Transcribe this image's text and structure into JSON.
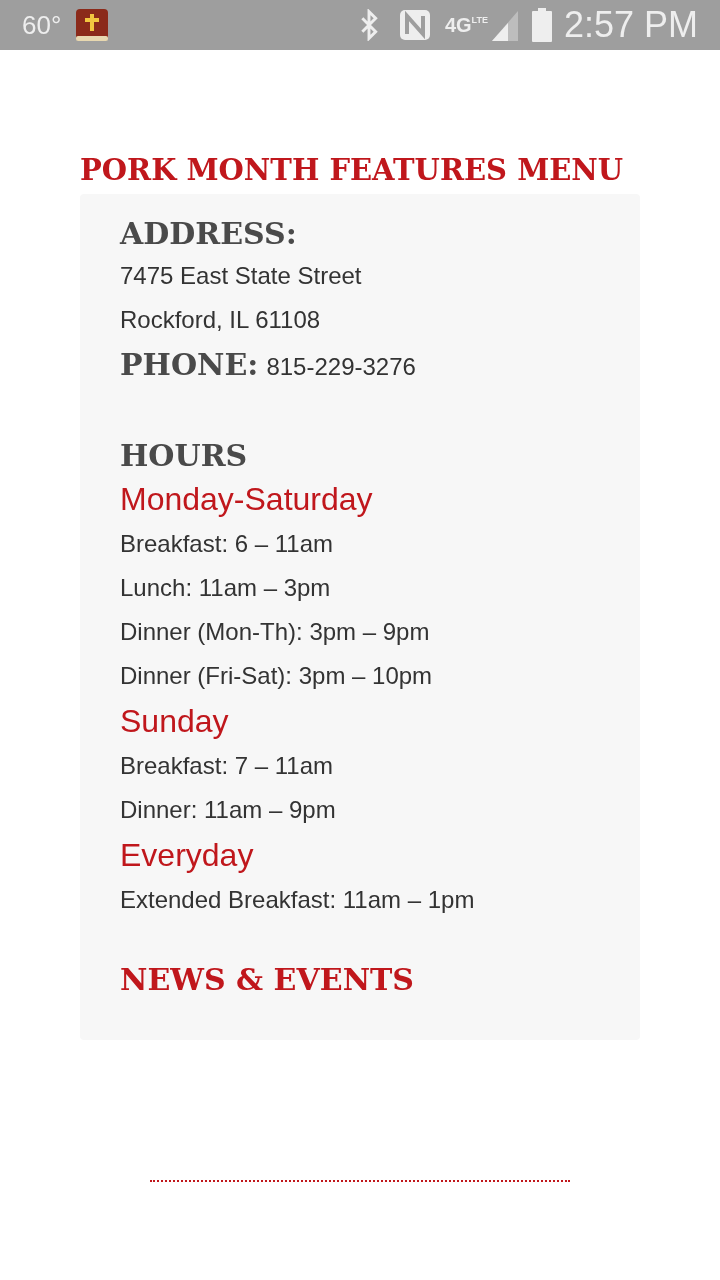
{
  "status_bar": {
    "temperature": "60°",
    "network": "4G",
    "network_sub": "LTE",
    "time": "2:57 PM"
  },
  "title": "PORK MONTH FEATURES MENU",
  "card": [
    {
      "kind": "heading",
      "text": "ADDRESS:"
    },
    {
      "kind": "line",
      "text": "7475 East State Street"
    },
    {
      "kind": "line",
      "text": "Rockford, IL 61108"
    },
    {
      "kind": "labeled",
      "label": "PHONE:",
      "value": "815-229-3276"
    },
    {
      "kind": "heading",
      "text": "HOURS"
    },
    {
      "kind": "day",
      "text": "Monday-Saturday"
    },
    {
      "kind": "line",
      "text": "Breakfast: 6 – 11am"
    },
    {
      "kind": "line",
      "text": "Lunch: 11am – 3pm"
    },
    {
      "kind": "line",
      "text": "Dinner (Mon-Th): 3pm – 9pm"
    },
    {
      "kind": "line",
      "text": "Dinner (Fri-Sat): 3pm – 10pm"
    },
    {
      "kind": "day",
      "text": "Sunday"
    },
    {
      "kind": "line",
      "text": "Breakfast: 7 – 11am"
    },
    {
      "kind": "line",
      "text": "Dinner: 11am – 9pm"
    },
    {
      "kind": "day",
      "text": "Everyday"
    },
    {
      "kind": "line",
      "text": "Extended Breakfast: 11am – 1pm"
    },
    {
      "kind": "link_heading",
      "text": "NEWS & EVENTS"
    }
  ]
}
